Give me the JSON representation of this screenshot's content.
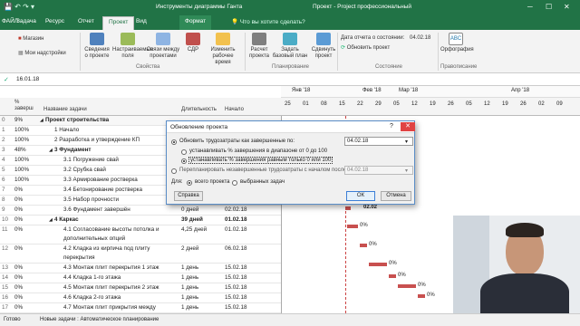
{
  "title": {
    "tool": "Инструменты диаграммы Ганта",
    "app": "Проект - Project профессиональный"
  },
  "tabs": [
    "Задача",
    "Ресурс",
    "Отчет",
    "Проект",
    "Вид",
    "Формат"
  ],
  "tell_me": "Что вы хотите сделать?",
  "ribbon": {
    "store": "Магазин",
    "addins": "Мои надстройки",
    "info": "Сведения о проекте",
    "fields": "Настраиваемые поля",
    "links": "Связи между проектами",
    "wbs": "СДР",
    "worktime": "Изменить рабочее время",
    "calc": "Расчет проекта",
    "baseline": "Задать базовый план",
    "move": "Сдвинуть проект",
    "status_date_label": "Дата отчета о состоянии:",
    "status_date": "04.02.18",
    "update": "Обновить проект",
    "spell": "Орфография",
    "g_props": "Свойства",
    "g_plan": "Планирование",
    "g_status": "Состояние",
    "g_check": "Правописание"
  },
  "formula_value": "16.01.18",
  "columns": {
    "pct": "% заверш",
    "name": "Название задачи",
    "dur": "Длительность",
    "start": "Начало"
  },
  "timeline": {
    "months": [
      "Янв '18",
      "Фев '18",
      "Мар '18",
      "Апр '18"
    ],
    "days": [
      "25",
      "01",
      "08",
      "15",
      "22",
      "29",
      "05",
      "12",
      "19",
      "26",
      "05",
      "12",
      "19",
      "26",
      "02",
      "09"
    ]
  },
  "rows": [
    {
      "id": "0",
      "pct": "9%",
      "name": "Проект строительства",
      "dur": "",
      "start": "",
      "bold": true,
      "lvl": 0
    },
    {
      "id": "1",
      "pct": "100%",
      "name": "1 Начало",
      "dur": "",
      "start": "",
      "lvl": 1
    },
    {
      "id": "2",
      "pct": "100%",
      "name": "2 Разработка и утверждение КП",
      "dur": "",
      "start": "",
      "lvl": 1
    },
    {
      "id": "3",
      "pct": "48%",
      "name": "3 Фундамент",
      "dur": "",
      "start": "",
      "bold": true,
      "lvl": 1
    },
    {
      "id": "4",
      "pct": "100%",
      "name": "3.1 Погружение свай",
      "dur": "",
      "start": "",
      "lvl": 2
    },
    {
      "id": "5",
      "pct": "100%",
      "name": "3.2 Срубка свай",
      "dur": "",
      "start": "",
      "lvl": 2
    },
    {
      "id": "6",
      "pct": "100%",
      "name": "3.3 Армирование ростверка",
      "dur": "",
      "start": "",
      "lvl": 2
    },
    {
      "id": "7",
      "pct": "0%",
      "name": "3.4 Бетонирование ростверка",
      "dur": "",
      "start": "",
      "lvl": 2
    },
    {
      "id": "8",
      "pct": "0%",
      "name": "3.5 Набор прочности",
      "dur": "",
      "start": "",
      "lvl": 2
    },
    {
      "id": "9",
      "pct": "0%",
      "name": "3.6 Фундамент завершён",
      "dur": "0 дней",
      "start": "02.02.18",
      "lvl": 2
    },
    {
      "id": "10",
      "pct": "0%",
      "name": "4 Каркас",
      "dur": "39 дней",
      "start": "01.02.18",
      "bold": true,
      "lvl": 1
    },
    {
      "id": "11",
      "pct": "0%",
      "name": "4.1 Согласование высоты потолка и дополнительных опций",
      "l1": "4.1 Согласование высоты потолка и",
      "l2": "дополнительных опций",
      "dur": "4,25 дней",
      "start": "01.02.18",
      "lvl": 2,
      "two": true
    },
    {
      "id": "12",
      "pct": "0%",
      "name": "4.2 Кладка из кирпича под плиту перекрытия",
      "l1": "4.2 Кладка из кирпича под плиту",
      "l2": "перекрытия",
      "dur": "2 дней",
      "start": "06.02.18",
      "lvl": 2,
      "two": true
    },
    {
      "id": "13",
      "pct": "0%",
      "name": "4.3 Монтаж плит перекрытия 1 этаж",
      "dur": "1 день",
      "start": "15.02.18",
      "lvl": 2
    },
    {
      "id": "14",
      "pct": "0%",
      "name": "4.4 Кладка 1-го этажа",
      "dur": "1 день",
      "start": "15.02.18",
      "lvl": 2
    },
    {
      "id": "15",
      "pct": "0%",
      "name": "4.5 Монтаж плит перекрытия 2 этаж",
      "dur": "1 день",
      "start": "15.02.18",
      "lvl": 2
    },
    {
      "id": "16",
      "pct": "0%",
      "name": "4.6 Кладка 2-го этажа",
      "dur": "1 день",
      "start": "15.02.18",
      "lvl": 2
    },
    {
      "id": "17",
      "pct": "0%",
      "name": "4.7 Монтаж плит прикрытия между",
      "dur": "1 день",
      "start": "15.02.18",
      "lvl": 2
    }
  ],
  "gantt_labels": [
    "02.02",
    "0%",
    "0%",
    "0%",
    "0%",
    "0%",
    "0%"
  ],
  "dialog": {
    "title": "Обновление проекта",
    "opt1": "Обновить трудозатраты как завершенные по:",
    "opt1_date": "04.02.18",
    "sub1": "устанавливать % завершения в диапазоне от 0 до 100",
    "sub2": "устанавливать % завершения равным только 0 или 100",
    "opt2": "Перепланировать незавершенные трудозатраты с началом после:",
    "opt2_date": "04.02.18",
    "for_label": "Для:",
    "whole": "всего проекта",
    "selected": "выбранных задач",
    "help": "Справка",
    "ok": "ОК",
    "cancel": "Отмена"
  },
  "status": {
    "ready": "Готово",
    "new_tasks": "Новые задачи : Автоматическое планирование"
  }
}
